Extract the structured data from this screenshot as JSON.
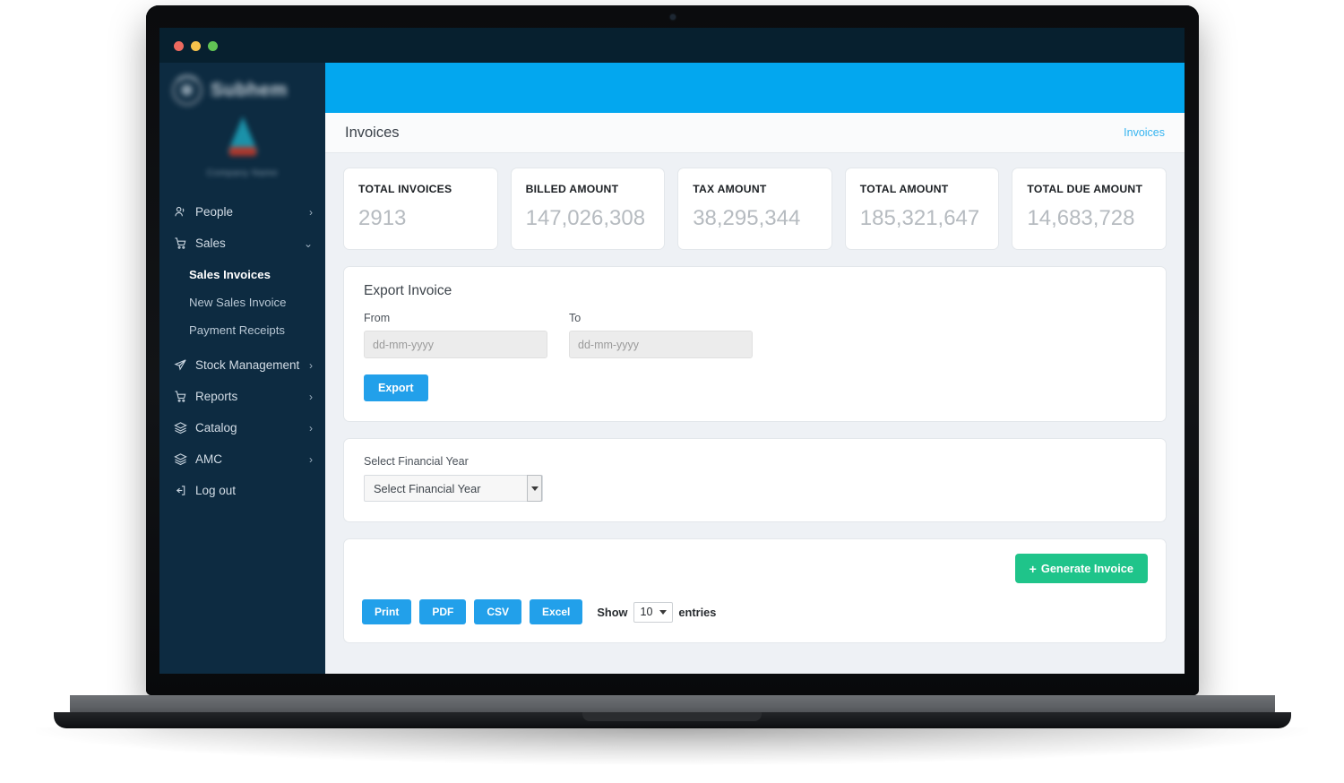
{
  "window": {
    "traffic_lights": [
      "close",
      "minimize",
      "maximize"
    ]
  },
  "sidebar": {
    "brand": {
      "name": "Subhem",
      "icon": "circle-logo-icon"
    },
    "org": {
      "name": "Company Name",
      "logo": "triangle-logo-icon"
    },
    "items": [
      {
        "label": "People",
        "icon": "people-icon",
        "chevron": "›",
        "expanded": false
      },
      {
        "label": "Sales",
        "icon": "cart-icon",
        "chevron": "⌄",
        "expanded": true
      },
      {
        "label": "Stock Management",
        "icon": "send-icon",
        "chevron": "›",
        "expanded": false
      },
      {
        "label": "Reports",
        "icon": "cart-icon",
        "chevron": "›",
        "expanded": false
      },
      {
        "label": "Catalog",
        "icon": "layers-icon",
        "chevron": "›",
        "expanded": false
      },
      {
        "label": "AMC",
        "icon": "layers-icon",
        "chevron": "›",
        "expanded": false
      },
      {
        "label": "Log out",
        "icon": "logout-icon",
        "chevron": "",
        "expanded": false
      }
    ],
    "sales_subitems": [
      {
        "label": "Sales Invoices",
        "active": true
      },
      {
        "label": "New Sales Invoice",
        "active": false
      },
      {
        "label": "Payment Receipts",
        "active": false
      }
    ]
  },
  "header": {
    "title": "Invoices",
    "breadcrumb": "Invoices",
    "topbar_color": "#03a7ef"
  },
  "stats": [
    {
      "label": "TOTAL INVOICES",
      "value": "2913"
    },
    {
      "label": "BILLED AMOUNT",
      "value": "147,026,308"
    },
    {
      "label": "TAX AMOUNT",
      "value": "38,295,344"
    },
    {
      "label": "TOTAL AMOUNT",
      "value": "185,321,647"
    },
    {
      "label": "TOTAL DUE AMOUNT",
      "value": "14,683,728"
    }
  ],
  "export_panel": {
    "title": "Export Invoice",
    "from_label": "From",
    "from_value": "",
    "from_placeholder": "dd-mm-yyyy",
    "to_label": "To",
    "to_value": "",
    "to_placeholder": "dd-mm-yyyy",
    "export_button": "Export"
  },
  "financial_year_panel": {
    "label": "Select Financial Year",
    "selected": "Select Financial Year"
  },
  "table_panel": {
    "generate_button": "Generate Invoice",
    "generate_icon": "plus-icon",
    "tools": [
      "Print",
      "PDF",
      "CSV",
      "Excel"
    ],
    "show_prefix": "Show",
    "page_length": "10",
    "show_suffix": "entries"
  },
  "colors": {
    "accent_blue": "#22a0ea",
    "topbar_blue": "#03a7ef",
    "green": "#1fc48a",
    "sidebar": "#0d2b41",
    "link": "#35b4f0"
  }
}
